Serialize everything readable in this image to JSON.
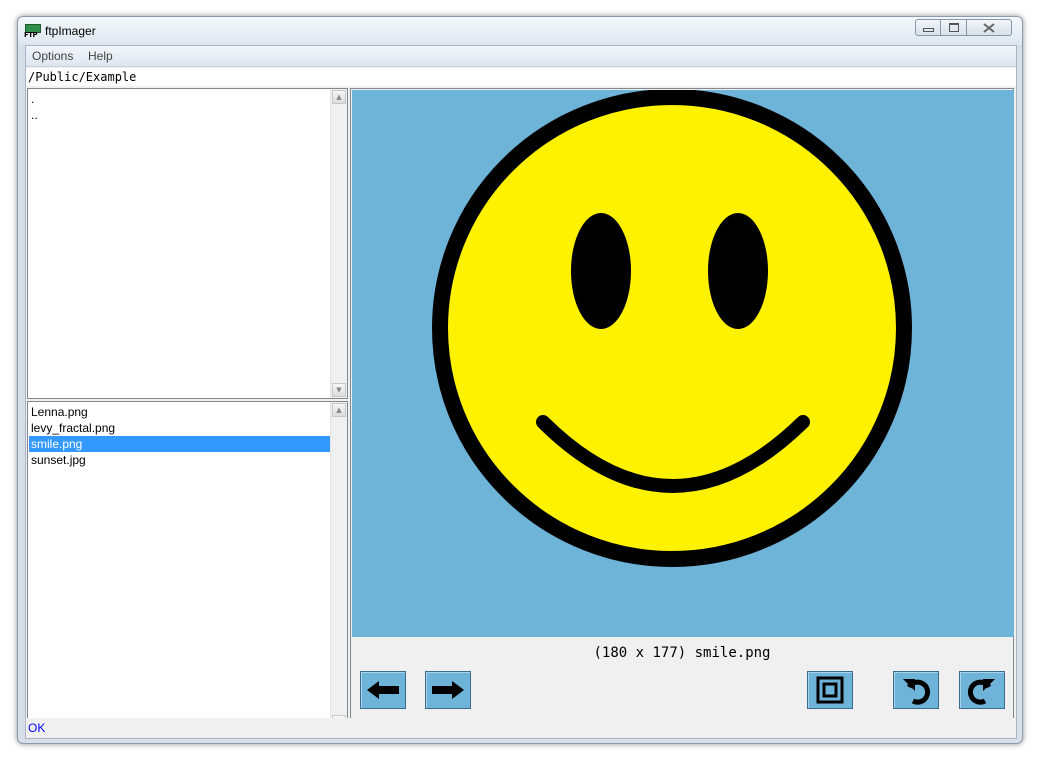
{
  "window": {
    "title": "ftpImager",
    "icon_text": "FTP"
  },
  "menu": {
    "items": [
      "Options",
      "Help"
    ]
  },
  "path": "/Public/Example",
  "directories": [
    ".",
    ".."
  ],
  "files": [
    {
      "name": "Lenna.png",
      "selected": false
    },
    {
      "name": "levy_fractal.png",
      "selected": false
    },
    {
      "name": "smile.png",
      "selected": true
    },
    {
      "name": "sunset.jpg",
      "selected": false
    }
  ],
  "image": {
    "caption": "(180 x 177) smile.png",
    "background_color": "#6eb3d8",
    "face_color": "#fff200",
    "outline_color": "#000000"
  },
  "toolbar": {
    "prev_icon": "arrow-left-icon",
    "next_icon": "arrow-right-icon",
    "fit_icon": "fit-window-icon",
    "rotate_left_icon": "rotate-left-icon",
    "rotate_right_icon": "rotate-right-icon"
  },
  "status": "OK",
  "colors": {
    "selection": "#3399ff",
    "status_text": "#0000ff",
    "button_face": "#6eb3d8"
  }
}
